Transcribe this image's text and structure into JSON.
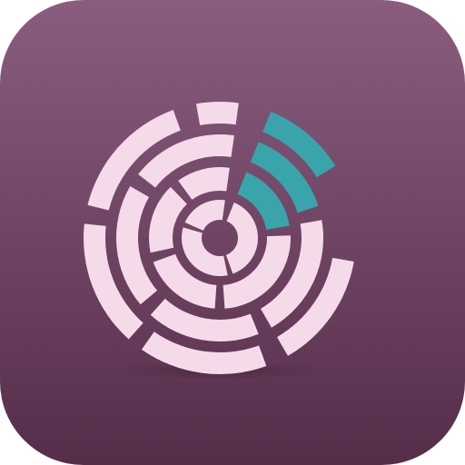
{
  "icon": {
    "name": "radial-arc-segments-icon",
    "colors": {
      "background_top": "#8a5d7f",
      "background_bottom": "#552d49",
      "segment": "#f5dbea",
      "accent": "#3aa4ab",
      "shadow": "#3a1d31"
    }
  }
}
